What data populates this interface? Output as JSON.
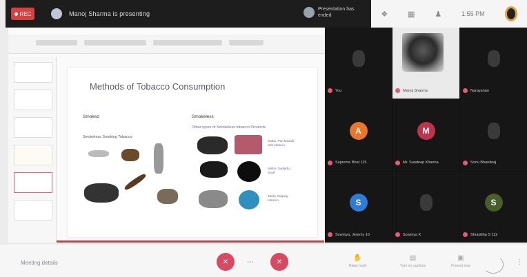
{
  "topbar": {
    "rec_label": "REC",
    "sharer": "Manoj Sharma is presenting",
    "host_line1": "Presentation has",
    "host_line2": "ended",
    "time": "1:55 PM"
  },
  "slide": {
    "title": "Methods of Tobacco Consumption",
    "col1_heading": "Smoked",
    "col1_sub": "Smokeless Smoking Tobacco",
    "col2_heading": "Smokeless",
    "col2_sub": "Other types of Smokeless tobacco Products"
  },
  "participants": [
    {
      "name": "You",
      "initial": "",
      "color": "#1a1a1a",
      "kind": "person"
    },
    {
      "name": "Manoj Sharma",
      "initial": "",
      "color": "#eaeaea",
      "kind": "video"
    },
    {
      "name": "Narayanan",
      "initial": "",
      "color": "#1a1a1a",
      "kind": "person"
    },
    {
      "name": "Supreme Bhat 115",
      "initial": "A",
      "color": "#e8762c",
      "kind": "letter"
    },
    {
      "name": "Mr. Sandeep Khanna",
      "initial": "M",
      "color": "#c0334d",
      "kind": "letter"
    },
    {
      "name": "Sonu Bhardwaj",
      "initial": "",
      "color": "#1a1a1a",
      "kind": "person"
    },
    {
      "name": "Sowmya, Jeremy 10",
      "initial": "S",
      "color": "#2f7bd8",
      "kind": "letter"
    },
    {
      "name": "Sowmya K",
      "initial": "",
      "color": "#1a1a1a",
      "kind": "person"
    },
    {
      "name": "Shraddha S 112",
      "initial": "S",
      "color": "#4a5e2a",
      "kind": "letter"
    }
  ],
  "bottombar": {
    "meeting_title": "Meeting details",
    "tool1": "Raise hand",
    "tool2": "Turn on captions",
    "tool3": "Present now"
  },
  "icons": {
    "mic_off": "mic-off-icon",
    "camera_off": "camera-off-icon",
    "more": "more-options-icon"
  }
}
